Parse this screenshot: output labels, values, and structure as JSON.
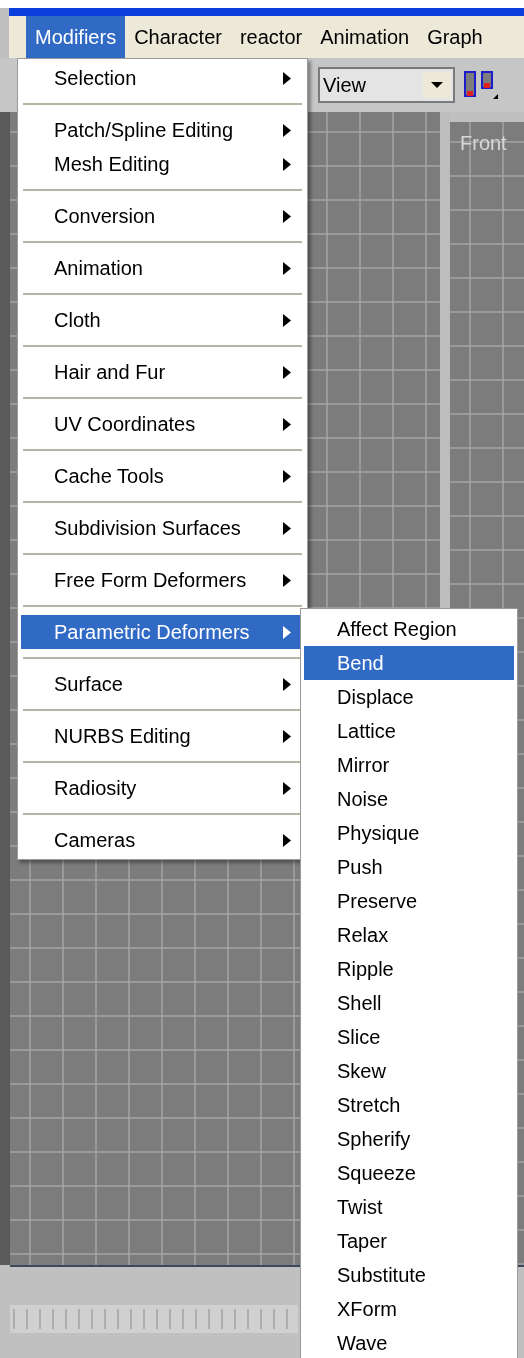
{
  "menu_bar": [
    {
      "label": "Modifiers",
      "selected": true
    },
    {
      "label": "Character",
      "selected": false
    },
    {
      "label": "reactor",
      "selected": false
    },
    {
      "label": "Animation",
      "selected": false
    },
    {
      "label": "Graph",
      "selected": false
    }
  ],
  "toolbar": {
    "view_dropdown": {
      "value": "View"
    }
  },
  "viewport": {
    "label": "Front"
  },
  "modifiers_menu": [
    {
      "items": [
        {
          "label": "Selection",
          "selected": false
        }
      ]
    },
    {
      "items": [
        {
          "label": "Patch/Spline Editing",
          "selected": false
        },
        {
          "label": "Mesh Editing",
          "selected": false
        }
      ]
    },
    {
      "items": [
        {
          "label": "Conversion",
          "selected": false
        }
      ]
    },
    {
      "items": [
        {
          "label": "Animation",
          "selected": false
        }
      ]
    },
    {
      "items": [
        {
          "label": "Cloth",
          "selected": false
        }
      ]
    },
    {
      "items": [
        {
          "label": "Hair and Fur",
          "selected": false
        }
      ]
    },
    {
      "items": [
        {
          "label": "UV Coordinates",
          "selected": false
        }
      ]
    },
    {
      "items": [
        {
          "label": "Cache Tools",
          "selected": false
        }
      ]
    },
    {
      "items": [
        {
          "label": "Subdivision Surfaces",
          "selected": false
        }
      ]
    },
    {
      "items": [
        {
          "label": "Free Form Deformers",
          "selected": false
        }
      ]
    },
    {
      "items": [
        {
          "label": "Parametric Deformers",
          "selected": true
        }
      ]
    },
    {
      "items": [
        {
          "label": "Surface",
          "selected": false
        }
      ]
    },
    {
      "items": [
        {
          "label": "NURBS Editing",
          "selected": false
        }
      ]
    },
    {
      "items": [
        {
          "label": "Radiosity",
          "selected": false
        }
      ]
    },
    {
      "items": [
        {
          "label": "Cameras",
          "selected": false
        }
      ]
    }
  ],
  "submenu": [
    {
      "label": "Affect Region",
      "selected": false
    },
    {
      "label": "Bend",
      "selected": true
    },
    {
      "label": "Displace",
      "selected": false
    },
    {
      "label": "Lattice",
      "selected": false
    },
    {
      "label": "Mirror",
      "selected": false
    },
    {
      "label": "Noise",
      "selected": false
    },
    {
      "label": "Physique",
      "selected": false
    },
    {
      "label": "Push",
      "selected": false
    },
    {
      "label": "Preserve",
      "selected": false
    },
    {
      "label": "Relax",
      "selected": false
    },
    {
      "label": "Ripple",
      "selected": false
    },
    {
      "label": "Shell",
      "selected": false
    },
    {
      "label": "Slice",
      "selected": false
    },
    {
      "label": "Skew",
      "selected": false
    },
    {
      "label": "Stretch",
      "selected": false
    },
    {
      "label": "Spherify",
      "selected": false
    },
    {
      "label": "Squeeze",
      "selected": false
    },
    {
      "label": "Twist",
      "selected": false
    },
    {
      "label": "Taper",
      "selected": false
    },
    {
      "label": "Substitute",
      "selected": false
    },
    {
      "label": "XForm",
      "selected": false
    },
    {
      "label": "Wave",
      "selected": false
    }
  ]
}
